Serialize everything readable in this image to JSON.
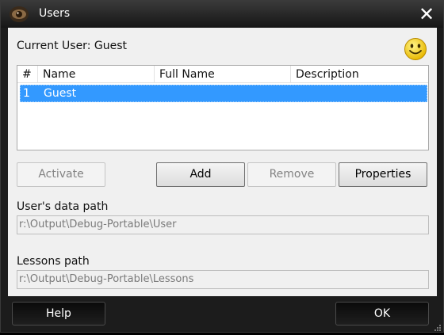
{
  "window": {
    "title": "Users",
    "close_symbol": "✕"
  },
  "current_user": {
    "label": "Current User: Guest",
    "status_icon": "smiley-icon"
  },
  "list": {
    "columns": [
      "#",
      "Name",
      "Full Name",
      "Description"
    ],
    "rows": [
      {
        "num": "1",
        "name": "Guest",
        "full_name": "",
        "description": "",
        "selected": true
      }
    ]
  },
  "buttons": {
    "activate": "Activate",
    "add": "Add",
    "remove": "Remove",
    "properties": "Properties"
  },
  "paths": {
    "data_label": "User's data path",
    "data_value": "r:\\Output\\Debug-Portable\\User",
    "lessons_label": "Lessons path",
    "lessons_value": "r:\\Output\\Debug-Portable\\Lessons"
  },
  "footer": {
    "help": "Help",
    "ok": "OK"
  },
  "colors": {
    "selection": "#3399ff",
    "titlebar": "#1c1c1c",
    "content_bg": "#f0f0f0"
  }
}
